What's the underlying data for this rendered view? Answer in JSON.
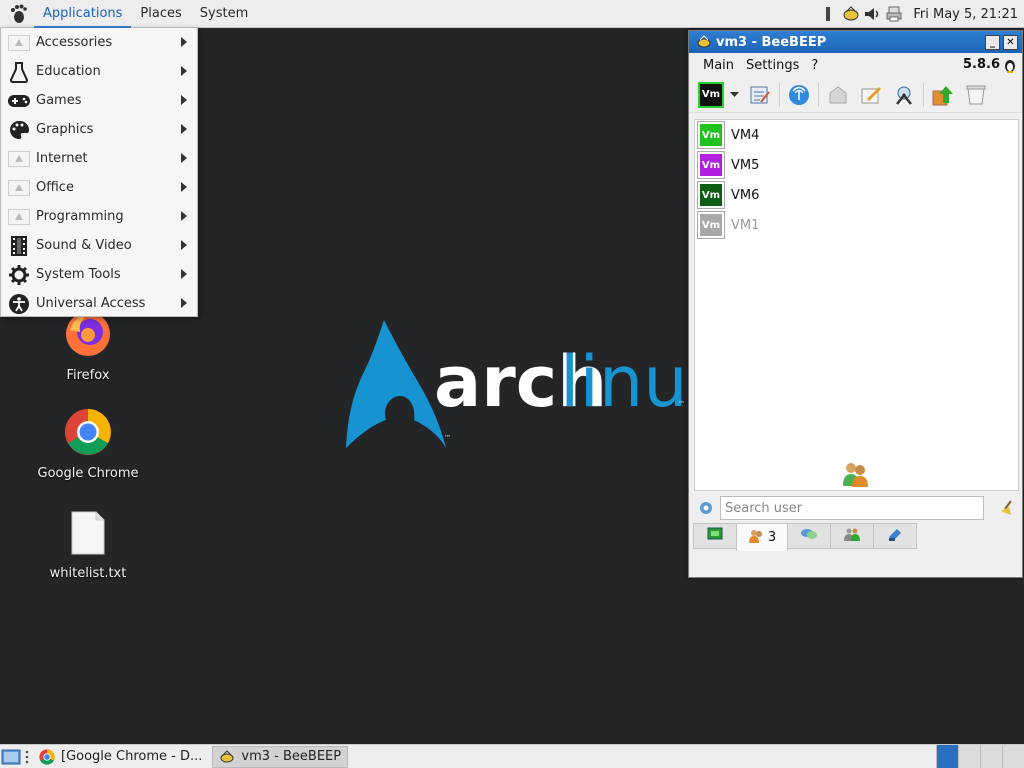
{
  "top_panel": {
    "menus": [
      {
        "label": "Applications"
      },
      {
        "label": "Places"
      },
      {
        "label": "System"
      }
    ],
    "clock": "Fri May  5, 21:21"
  },
  "app_menu": {
    "items": [
      {
        "label": "Accessories",
        "icon": "broken-image-icon"
      },
      {
        "label": "Education",
        "icon": "flask-icon"
      },
      {
        "label": "Games",
        "icon": "gamepad-icon"
      },
      {
        "label": "Graphics",
        "icon": "palette-icon"
      },
      {
        "label": "Internet",
        "icon": "broken-image-icon"
      },
      {
        "label": "Office",
        "icon": "broken-image-icon"
      },
      {
        "label": "Programming",
        "icon": "broken-image-icon"
      },
      {
        "label": "Sound & Video",
        "icon": "film-icon"
      },
      {
        "label": "System Tools",
        "icon": "gear-icon"
      },
      {
        "label": "Universal Access",
        "icon": "accessibility-icon"
      }
    ]
  },
  "desktop": {
    "icons": [
      {
        "label": "Firefox"
      },
      {
        "label": "Google Chrome"
      },
      {
        "label": "whitelist.txt"
      }
    ],
    "wallpaper_logo": {
      "word1": "arch",
      "word2": "linux",
      "tm": "™"
    }
  },
  "beebeep": {
    "title": "vm3 - BeeBEEP",
    "minimize": "_",
    "close": "✕",
    "menus": [
      {
        "label": "Main"
      },
      {
        "label": "Settings"
      },
      {
        "label": "?"
      }
    ],
    "version": "5.8.6",
    "my_badge": "Vm",
    "users": [
      {
        "badge": "Vm",
        "name": "VM4",
        "color": "#1fc21f",
        "online": true
      },
      {
        "badge": "Vm",
        "name": "VM5",
        "color": "#b11fe0",
        "online": true
      },
      {
        "badge": "Vm",
        "name": "VM6",
        "color": "#0d5d12",
        "online": true
      },
      {
        "badge": "Vm",
        "name": "VM1",
        "color": "#a9a9a9",
        "online": false
      }
    ],
    "search_placeholder": "Search user",
    "users_tab_count": "3"
  },
  "taskbar": {
    "tasks": [
      {
        "label": "[Google Chrome - D..."
      },
      {
        "label": "vm3 - BeeBEEP"
      }
    ]
  }
}
